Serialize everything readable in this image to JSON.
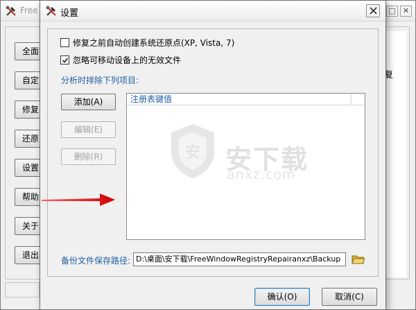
{
  "main_window": {
    "title": "Free",
    "right_text": "复",
    "side_buttons": [
      "全面扫",
      "自定",
      "修复",
      "还原",
      "设置",
      "帮助",
      "关于",
      "退出"
    ]
  },
  "dialog": {
    "title": "设置",
    "options": [
      {
        "label": "修复之前自动创建系统还原点(XP, Vista, 7)",
        "checked": false
      },
      {
        "label": "忽略可移动设备上的无效文件",
        "checked": true
      }
    ],
    "exclude_label": "分析时排除下列项目:",
    "buttons": {
      "add": "添加(A)",
      "edit": "编辑(E)",
      "delete": "删除(R)"
    },
    "list": {
      "column_header": "注册表键值",
      "rows": []
    },
    "backup": {
      "label": "备份文件保存路径:",
      "value": "D:\\桌面\\安下载\\FreeWindowRegistryRepairanxz\\Backup"
    },
    "ok_label": "确认(O)",
    "cancel_label": "取消(C)"
  },
  "watermark": {
    "text": "安下载",
    "sub": "anxz.com"
  },
  "colors": {
    "accent_text": "#1f5fa5",
    "arrow": "#e01010",
    "disabled_text": "#a0a0a0"
  }
}
